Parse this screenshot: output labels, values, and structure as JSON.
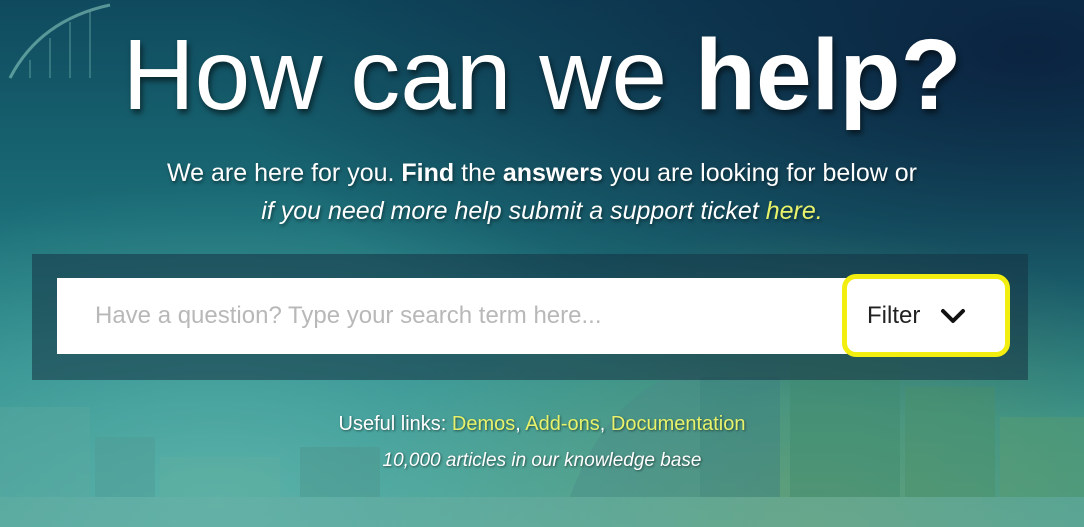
{
  "headline": {
    "regular": "How can we ",
    "bold": "help?"
  },
  "subtext": {
    "line1_part1": "We are here for you. ",
    "line1_bold1": "Find",
    "line1_part2": " the ",
    "line1_bold2": "answers",
    "line1_part3": " you are looking for below or",
    "line2_italic": "if you need more help submit a support ticket ",
    "line2_link": "here."
  },
  "search": {
    "placeholder": "Have a question? Type your search term here...",
    "value": ""
  },
  "filter": {
    "label": "Filter",
    "highlight_color": "#f2ee10"
  },
  "useful_links": {
    "prefix": "Useful links: ",
    "links": [
      "Demos",
      "Add-ons",
      "Documentation"
    ],
    "separator": ", ",
    "link_color": "#e8f26a"
  },
  "articles_text": "10,000 articles in our knowledge base"
}
